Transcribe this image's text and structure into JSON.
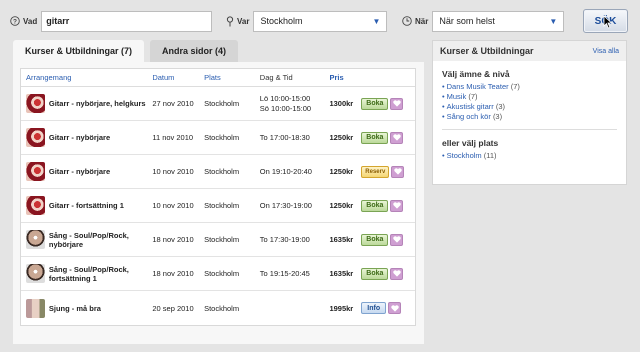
{
  "search": {
    "what_label": "Vad",
    "what_value": "gitarr",
    "where_label": "Var",
    "where_value": "Stockholm",
    "when_label": "När",
    "when_value": "När som helst",
    "button_label": "SÖK"
  },
  "tabs": [
    {
      "label": "Kurser & Utbildningar (7)",
      "active": true
    },
    {
      "label": "Andra sidor (4)",
      "active": false
    }
  ],
  "table": {
    "headers": {
      "event": "Arrangemang",
      "date": "Datum",
      "place": "Plats",
      "daytime": "Dag & Tid",
      "price": "Pris"
    },
    "rows": [
      {
        "thumb": "guitar",
        "name": "Gitarr - nybörjare, helgkurs",
        "date": "27 nov 2010",
        "place": "Stockholm",
        "time1": "Lö 10:00-15:00",
        "time2": "Sö 10:00-15:00",
        "price": "1300kr",
        "action": "Boka",
        "action_type": "boka"
      },
      {
        "thumb": "guitar",
        "name": "Gitarr - nybörjare",
        "date": "11 nov 2010",
        "place": "Stockholm",
        "time1": "To 17:00-18:30",
        "time2": "",
        "price": "1250kr",
        "action": "Boka",
        "action_type": "boka"
      },
      {
        "thumb": "guitar",
        "name": "Gitarr - nybörjare",
        "date": "10 nov 2010",
        "place": "Stockholm",
        "time1": "On 19:10-20:40",
        "time2": "",
        "price": "1250kr",
        "action": "Reserv",
        "action_type": "reserv"
      },
      {
        "thumb": "guitar",
        "name": "Gitarr - fortsättning 1",
        "date": "10 nov 2010",
        "place": "Stockholm",
        "time1": "On 17:30-19:00",
        "time2": "",
        "price": "1250kr",
        "action": "Boka",
        "action_type": "boka"
      },
      {
        "thumb": "singer",
        "name": "Sång - Soul/Pop/Rock, nybörjare",
        "date": "18 nov 2010",
        "place": "Stockholm",
        "time1": "To 17:30-19:00",
        "time2": "",
        "price": "1635kr",
        "action": "Boka",
        "action_type": "boka"
      },
      {
        "thumb": "singer",
        "name": "Sång - Soul/Pop/Rock, fortsättning 1",
        "date": "18 nov 2010",
        "place": "Stockholm",
        "time1": "To 19:15-20:45",
        "time2": "",
        "price": "1635kr",
        "action": "Boka",
        "action_type": "boka"
      },
      {
        "thumb": "sjung",
        "name": "Sjung - må bra",
        "date": "20 sep 2010",
        "place": "Stockholm",
        "time1": "",
        "time2": "",
        "price": "1995kr",
        "action": "Info",
        "action_type": "info"
      }
    ]
  },
  "sidebar": {
    "title": "Kurser & Utbildningar",
    "show_all": "Visa alla",
    "subject_heading": "Välj ämne & nivå",
    "subjects": [
      {
        "label": "Dans Musik Teater",
        "count": "(7)"
      },
      {
        "label": "Musik",
        "count": "(7)"
      },
      {
        "label": "Akustisk gitarr",
        "count": "(3)"
      },
      {
        "label": "Sång och kör",
        "count": "(3)"
      }
    ],
    "place_heading": "eller välj plats",
    "places": [
      {
        "label": "Stockholm",
        "count": "(11)"
      }
    ]
  },
  "colors": {
    "link": "#2a5db0",
    "boka": "#bcd99a",
    "reserv": "#f4d573",
    "info": "#c6d9f0",
    "heart": "#cf9fd2"
  }
}
